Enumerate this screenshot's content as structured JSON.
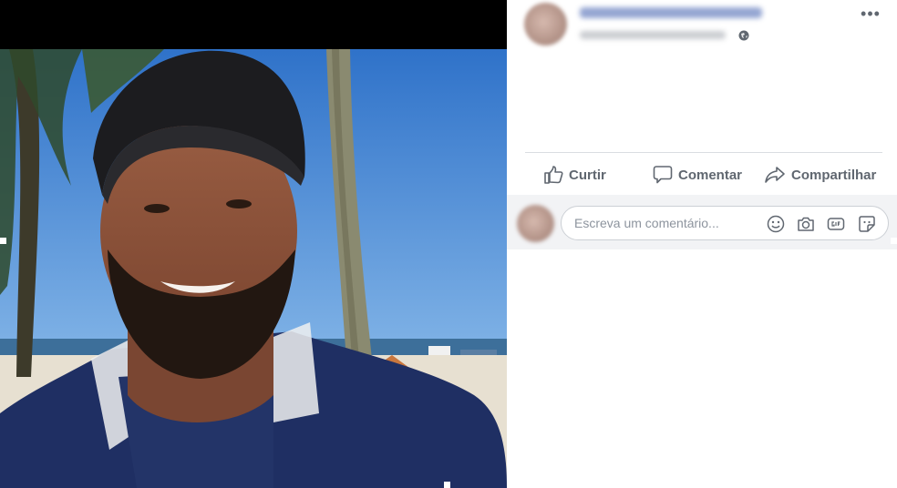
{
  "post": {
    "actions": {
      "like_label": "Curtir",
      "comment_label": "Comentar",
      "share_label": "Compartilhar"
    },
    "comment_input": {
      "placeholder": "Escreva um comentário..."
    },
    "icons": [
      "more-options-icon",
      "globe-icon",
      "like-icon",
      "comment-icon",
      "share-icon",
      "emoji-icon",
      "camera-icon",
      "gif-icon",
      "sticker-icon"
    ]
  },
  "colors": {
    "action_text": "#606770",
    "comment_bar_bg": "#f2f3f5",
    "input_border": "#ccd0d5",
    "placeholder": "#8d949e"
  }
}
